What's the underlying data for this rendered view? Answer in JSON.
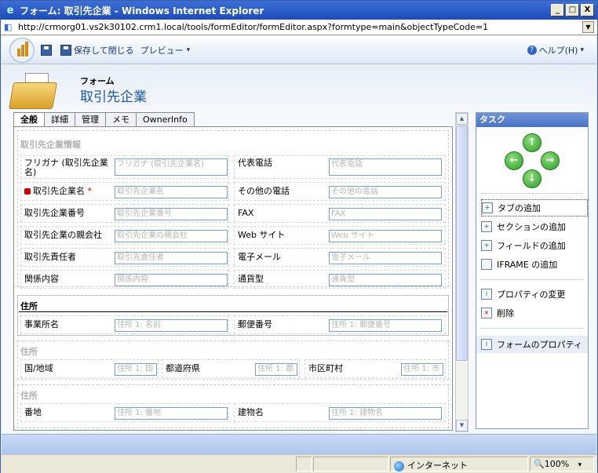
{
  "window": {
    "title": "フォーム: 取引先企業 - Windows Internet Explorer",
    "minimize": "_",
    "maximize": "□",
    "close": "X"
  },
  "address": {
    "url": "http://crmorg01.vs2k30102.crm1.local/tools/formEditor/formEditor.aspx?formtype=main&objectTypeCode=1"
  },
  "toolbar": {
    "save_close": "保存して閉じる",
    "preview": "プレビュー",
    "preview_arrow": "▾",
    "help": "ヘルプ(H)",
    "help_arrow": "▾"
  },
  "header": {
    "subtitle": "フォーム",
    "title": "取引先企業"
  },
  "tabs": [
    "全般",
    "詳細",
    "管理",
    "メモ",
    "OwnerInfo"
  ],
  "form": {
    "sec1_title": "取引先企業情報",
    "sec2_title": "住所",
    "sec3_title": "住所",
    "sec4_title": "住所",
    "fields": {
      "furigana_label": "フリガナ (取引先企業名)",
      "furigana_ph": "フリガナ (取引先企業名)",
      "phone_label": "代表電話",
      "phone_ph": "代表電話",
      "name_label": "取引先企業名",
      "name_req": "*",
      "name_ph": "取引先企業名",
      "otherphone_label": "その他の電話",
      "otherphone_ph": "その他の電話",
      "number_label": "取引先企業番号",
      "number_ph": "取引先企業番号",
      "fax_label": "FAX",
      "fax_ph": "FAX",
      "parent_label": "取引先企業の親会社",
      "parent_ph": "取引先企業の親会社",
      "web_label": "Web サイト",
      "web_ph": "Web サイト",
      "owner_label": "取引先責任者",
      "owner_ph": "取引先責任者",
      "email_label": "電子メール",
      "email_ph": "電子メール",
      "relation_label": "関係内容",
      "relation_ph": "関係内容",
      "currency_label": "通貨型",
      "currency_ph": "通貨型",
      "office_label": "事業所名",
      "office_ph": "住所 1: 名前",
      "zip_label": "郵便番号",
      "zip_ph": "住所 1: 郵便番号",
      "country_label": "国/地域",
      "country_ph": "住所 1: 国",
      "state_label": "都道府県",
      "state_ph": "住所 1: 都",
      "city_label": "市区町村",
      "city_ph": "住所 1: 市",
      "street_label": "番地",
      "street_ph": "住所 1: 番地",
      "building_label": "建物名",
      "building_ph": "住所 1: 建物名"
    }
  },
  "tasks": {
    "title": "タスク",
    "items": [
      "タブの追加",
      "セクションの追加",
      "フィールドの追加",
      "IFRAME の追加",
      "プロパティの変更",
      "削除",
      "フォームのプロパティ"
    ]
  },
  "statusbar": {
    "zone": "インターネット",
    "zoom": "100%",
    "zoom_arrow": "▾"
  }
}
